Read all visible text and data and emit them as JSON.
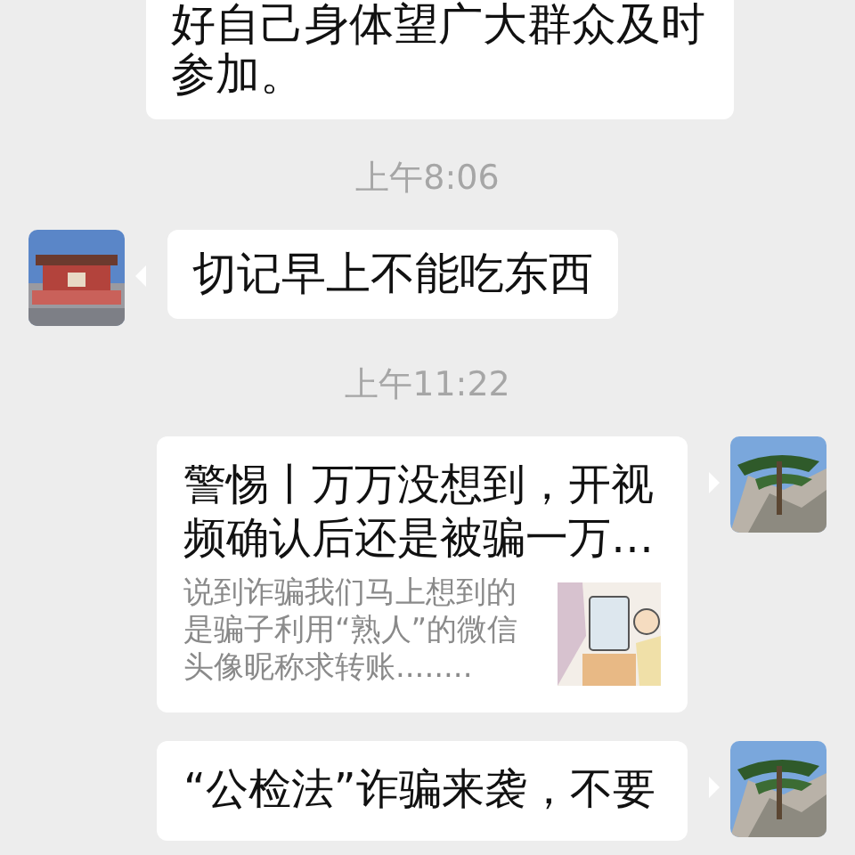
{
  "messages": [
    {
      "kind": "continued_text",
      "text": "好自己身体望广大群众及时参加。"
    },
    {
      "kind": "time",
      "text": "上午8:06"
    },
    {
      "kind": "received_text",
      "text": "切记早上不能吃东西"
    },
    {
      "kind": "time",
      "text": "上午11:22"
    },
    {
      "kind": "sent_link",
      "title": "警惕丨万万没想到，开视频确认后还是被骗一万…",
      "description": "说到诈骗我们马上想到的是骗子利用“熟人”的微信头像昵称求转账........"
    },
    {
      "kind": "sent_link",
      "title": "“公检法”诈骗来袭，不要"
    }
  ]
}
